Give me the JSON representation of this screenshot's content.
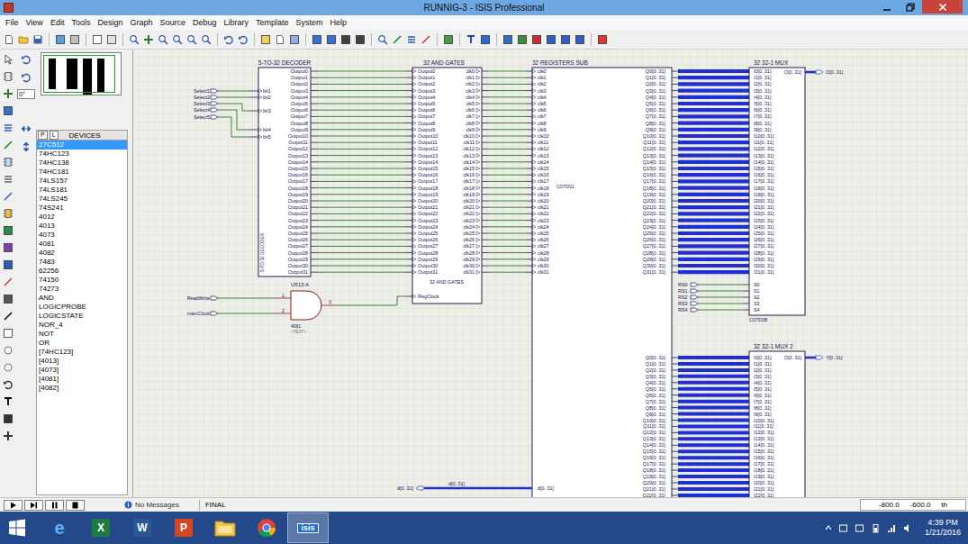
{
  "window": {
    "title": "RUNNIG-3 - ISIS Professional"
  },
  "menu": [
    "File",
    "View",
    "Edit",
    "Tools",
    "Design",
    "Graph",
    "Source",
    "Debug",
    "Library",
    "Template",
    "System",
    "Help"
  ],
  "tool_panel": {
    "angle": "0°",
    "pick_buttons": [
      "P",
      "L"
    ],
    "list_title": "DEVICES",
    "devices": [
      {
        "label": "27C512",
        "selected": true
      },
      {
        "label": "74HC123",
        "selected": false
      },
      {
        "label": "74HC138",
        "selected": false
      },
      {
        "label": "74HC181",
        "selected": false
      },
      {
        "label": "74LS157",
        "selected": false
      },
      {
        "label": "74LS181",
        "selected": false
      },
      {
        "label": "74LS245",
        "selected": false
      },
      {
        "label": "74S241",
        "selected": false
      },
      {
        "label": "4012",
        "selected": false
      },
      {
        "label": "4013",
        "selected": false
      },
      {
        "label": "4073",
        "selected": false
      },
      {
        "label": "4081",
        "selected": false
      },
      {
        "label": "4082",
        "selected": false
      },
      {
        "label": "7483",
        "selected": false
      },
      {
        "label": "62256",
        "selected": false
      },
      {
        "label": "74150",
        "selected": false
      },
      {
        "label": "74273",
        "selected": false
      },
      {
        "label": "AND",
        "selected": false
      },
      {
        "label": "LOGICPROBE",
        "selected": false
      },
      {
        "label": "LOGICSTATE",
        "selected": false
      },
      {
        "label": "NOR_4",
        "selected": false
      },
      {
        "label": "NOT",
        "selected": false
      },
      {
        "label": "OR",
        "selected": false
      },
      {
        "label": "[74HC123]",
        "selected": false
      },
      {
        "label": "[4013]",
        "selected": false
      },
      {
        "label": "[4073]",
        "selected": false
      },
      {
        "label": "[4081]",
        "selected": false
      },
      {
        "label": "[4082]",
        "selected": false
      }
    ]
  },
  "schematic": {
    "decoder": {
      "title": "5-TO-32 DECODER",
      "side_label": "5-TO-32 DECODER",
      "inputs": [
        {
          "terminal": "Select1",
          "pin": "bit1"
        },
        {
          "terminal": "Select2",
          "pin": "bit2"
        },
        {
          "terminal": "Select3",
          "pin": "bit3"
        },
        {
          "terminal": "Select4",
          "pin": "bit4"
        },
        {
          "terminal": "Select5",
          "pin": "bit5"
        }
      ],
      "outputs": [
        "Output0",
        "Output1",
        "Output2",
        "Output3",
        "Output4",
        "Output5",
        "Output6",
        "Output7",
        "Output8",
        "Output9",
        "Output10",
        "Output11",
        "Output12",
        "Output13",
        "Output14",
        "Output15",
        "Output16",
        "Output17",
        "Output18",
        "Output19",
        "Output20",
        "Output21",
        "Output22",
        "Output23",
        "Output24",
        "Output25",
        "Output26",
        "Output27",
        "Output28",
        "Output29",
        "Output30",
        "Output31"
      ]
    },
    "and_gates": {
      "title": "32 AND GATES",
      "inner_label": "32 AND GATES",
      "clock_pin": "RegClock",
      "inputs": [
        "Output0",
        "Output1",
        "Output2",
        "Output3",
        "Output4",
        "Output5",
        "Output6",
        "Output7",
        "Output8",
        "Output9",
        "Output10",
        "Output11",
        "Output12",
        "Output13",
        "Output14",
        "Output15",
        "Output16",
        "Output17",
        "Output18",
        "Output19",
        "Output20",
        "Output21",
        "Output22",
        "Output23",
        "Output24",
        "Output25",
        "Output26",
        "Output27",
        "Output28",
        "Output29",
        "Output30",
        "Output31"
      ],
      "outputs": [
        "clk0",
        "clk1",
        "clk2",
        "clk3",
        "clk4",
        "clk5",
        "clk6",
        "clk7",
        "clk8",
        "clk9",
        "clk10",
        "clk11",
        "clk12",
        "clk13",
        "clk14",
        "clk15",
        "clk16",
        "clk17",
        "clk18",
        "clk19",
        "clk20",
        "clk21",
        "clk22",
        "clk23",
        "clk24",
        "clk25",
        "clk26",
        "clk27",
        "clk28",
        "clk29",
        "clk30",
        "clk31"
      ]
    },
    "registers": {
      "title": "32 REGISTERS SUB",
      "ref": "COTD01",
      "clocks": [
        "clk0",
        "clk1",
        "clk2",
        "clk3",
        "clk4",
        "clk5",
        "clk6",
        "clk7",
        "clk8",
        "clk9",
        "clk10",
        "clk11",
        "clk12",
        "clk13",
        "clk14",
        "clk15",
        "clk16",
        "clk17",
        "clk18",
        "clk19",
        "clk20",
        "clk21",
        "clk22",
        "clk23",
        "clk24",
        "clk25",
        "clk26",
        "clk27",
        "clk28",
        "clk29",
        "clk30",
        "clk31"
      ],
      "outputs_a": [
        "Q0[0..31]",
        "Q1[0..31]",
        "Q2[0..31]",
        "Q3[0..31]",
        "Q4[0..31]",
        "Q5[0..31]",
        "Q6[0..31]",
        "Q7[0..31]",
        "Q8[0..31]",
        "Q9[0..31]",
        "Q10[0..31]",
        "Q11[0..31]",
        "Q12[0..31]",
        "Q13[0..31]",
        "Q14[0..31]",
        "Q15[0..31]",
        "Q16[0..31]",
        "Q17[0..31]",
        "Q18[0..31]",
        "Q19[0..31]",
        "Q20[0..31]",
        "Q21[0..31]",
        "Q22[0..31]",
        "Q23[0..31]",
        "Q24[0..31]",
        "Q25[0..31]",
        "Q26[0..31]",
        "Q27[0..31]",
        "Q28[0..31]",
        "Q29[0..31]",
        "Q30[0..31]",
        "Q31[0..31]"
      ],
      "outputs_b": [
        "Q0[0..31]",
        "Q1[0..31]",
        "Q2[0..31]",
        "Q3[0..31]",
        "Q4[0..31]",
        "Q5[0..31]",
        "Q6[0..31]",
        "Q7[0..31]",
        "Q8[0..31]",
        "Q9[0..31]",
        "Q10[0..31]",
        "Q11[0..31]",
        "Q12[0..31]",
        "Q13[0..31]",
        "Q14[0..31]",
        "Q15[0..31]",
        "Q16[0..31]",
        "Q17[0..31]",
        "Q18[0..31]",
        "Q19[0..31]",
        "Q20[0..31]",
        "Q21[0..31]",
        "Q22[0..31]"
      ],
      "data_pin": "d[0..31]",
      "data_bus_label": "d[0..31]",
      "data_terminal": "d[0..31]"
    },
    "mux1": {
      "title": "32 32-1 MUX",
      "ref": "COTD0B",
      "inputs": [
        "I0[0..31]",
        "I1[0..31]",
        "I2[0..31]",
        "I3[0..31]",
        "I4[0..31]",
        "I5[0..31]",
        "I6[0..31]",
        "I7[0..31]",
        "I8[0..31]",
        "I9[0..31]",
        "I10[0..31]",
        "I11[0..31]",
        "I12[0..31]",
        "I13[0..31]",
        "I14[0..31]",
        "I15[0..31]",
        "I16[0..31]",
        "I17[0..31]",
        "I18[0..31]",
        "I19[0..31]",
        "I20[0..31]",
        "I21[0..31]",
        "I22[0..31]",
        "I23[0..31]",
        "I24[0..31]",
        "I25[0..31]",
        "I26[0..31]",
        "I27[0..31]",
        "I28[0..31]",
        "I29[0..31]",
        "I30[0..31]",
        "I31[0..31]"
      ],
      "selects": [
        {
          "terminal": "RS0",
          "pin": "S0"
        },
        {
          "terminal": "RS1",
          "pin": "S1"
        },
        {
          "terminal": "RS2",
          "pin": "S2"
        },
        {
          "terminal": "RS3",
          "pin": "S3"
        },
        {
          "terminal": "RS4",
          "pin": "S4"
        }
      ],
      "output_pin": "O[0..31]",
      "output_terminal": "O[0..31]"
    },
    "mux2": {
      "title": "32 32-1 MUX 2",
      "inputs": [
        "I0[0..31]",
        "I1[0..31]",
        "I2[0..31]",
        "I3[0..31]",
        "I4[0..31]",
        "I5[0..31]",
        "I6[0..31]",
        "I7[0..31]",
        "I8[0..31]",
        "I9[0..31]",
        "I10[0..31]",
        "I11[0..31]",
        "I12[0..31]",
        "I13[0..31]",
        "I14[0..31]",
        "I15[0..31]",
        "I16[0..31]",
        "I17[0..31]",
        "I18[0..31]",
        "I19[0..31]",
        "I20[0..31]",
        "I21[0..31]",
        "I22[0..31]"
      ],
      "output_pin": "O[0..31]",
      "output_terminal": "Y[0..31]"
    },
    "gate": {
      "ref": "U513:A",
      "part": "4081",
      "text": "<TEXT>",
      "pin_numbers": [
        "1",
        "2",
        "3"
      ],
      "inputs": [
        "ReadWrite",
        "mainClock"
      ]
    }
  },
  "status_bar": {
    "message": "No Messages",
    "layer": "FINAL",
    "x": "-800.0",
    "y": "-600.0",
    "units": "th"
  },
  "taskbar": {
    "apps": [
      {
        "kind": "ie",
        "label": "e",
        "selected": false
      },
      {
        "kind": "excel",
        "label": "X",
        "selected": false
      },
      {
        "kind": "word",
        "label": "W",
        "selected": false
      },
      {
        "kind": "powerpoint",
        "label": "P",
        "selected": false
      },
      {
        "kind": "explorer",
        "selected": false
      },
      {
        "kind": "chrome",
        "selected": false
      },
      {
        "kind": "isis",
        "label": "isis",
        "selected": true
      }
    ],
    "clock": {
      "time": "4:39 PM",
      "date": "1/21/2016"
    }
  }
}
